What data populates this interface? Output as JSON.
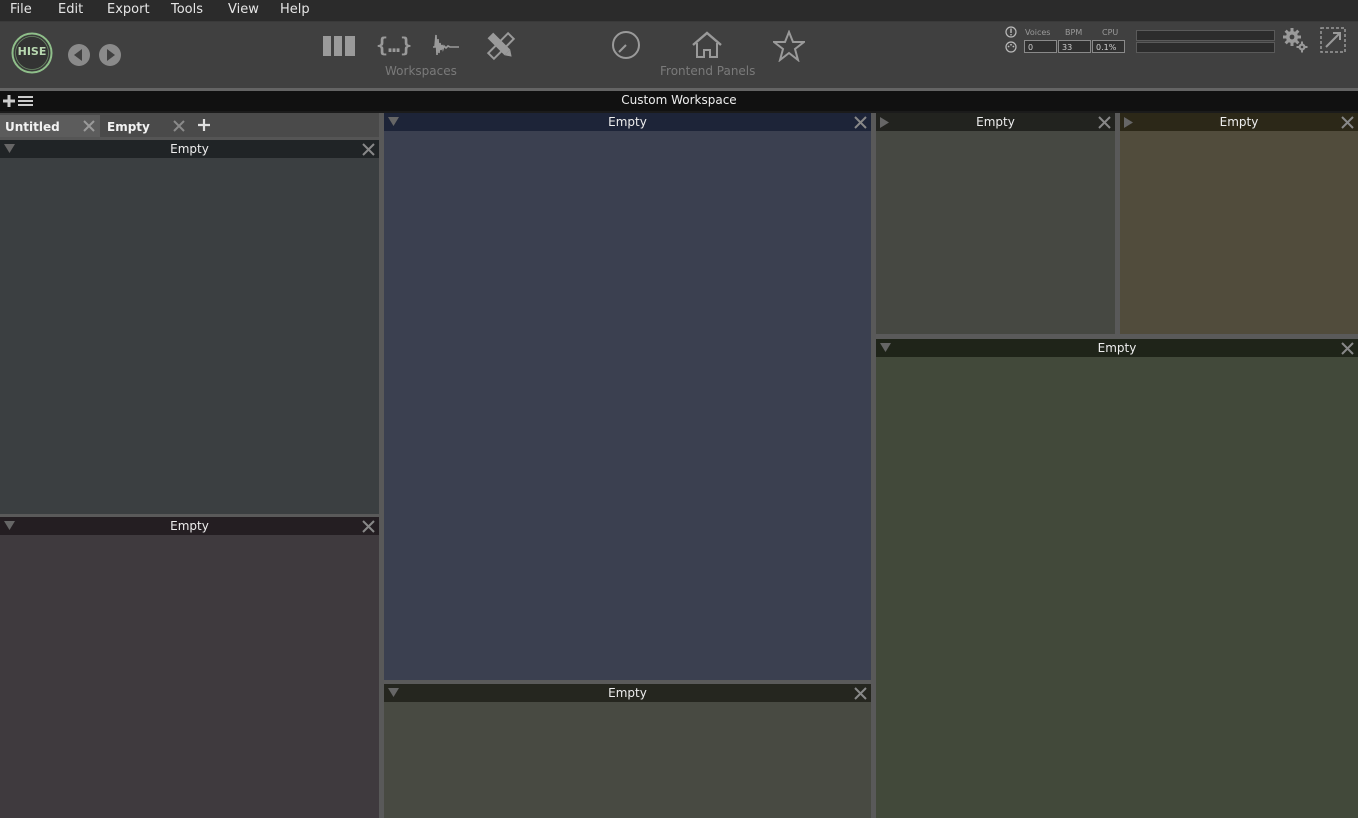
{
  "menu": [
    "File",
    "Edit",
    "Export",
    "Tools",
    "View",
    "Help"
  ],
  "toolbar": {
    "logo": "HISE",
    "workspaces_label": "Workspaces",
    "frontend_label": "Frontend Panels"
  },
  "stats": {
    "voices_label": "Voices",
    "bpm_label": "BPM",
    "cpu_label": "CPU",
    "voices_value": "0",
    "bpm_value": "33",
    "cpu_value": "0.1%"
  },
  "workspace_title": "Custom Workspace",
  "tabs": [
    {
      "label": "Untitled"
    },
    {
      "label": "Empty"
    }
  ],
  "panels": {
    "left_top": "Empty",
    "left_bottom": "Empty",
    "center_top": "Empty",
    "center_bottom": "Empty",
    "right_top_left": "Empty",
    "right_top_right": "Empty",
    "right_bottom": "Empty"
  },
  "colors": {
    "left_top": "#3b3f41",
    "left_bottom": "#3f3a3e",
    "center_top": "#3b4050",
    "center_bottom": "#484a42",
    "right_top_left": "#464842",
    "right_top_right": "#514c3c",
    "right_bottom": "#42493a"
  }
}
